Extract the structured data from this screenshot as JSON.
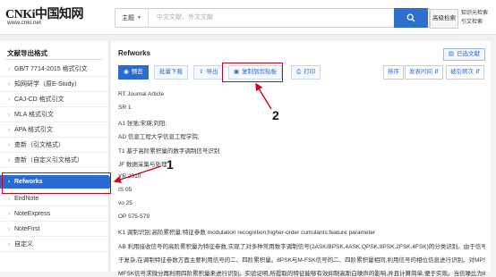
{
  "header": {
    "logo_text": "CNKi中国知网",
    "logo_url": "www.cnki.net",
    "search_select": "主题",
    "search_placeholder": "中文文献、外文文献",
    "adv_search": "高级检索",
    "right_links": [
      "知识元检索",
      "引文检索"
    ]
  },
  "sidebar": {
    "title": "文献导出格式",
    "items": [
      {
        "label": "GB/T 7714-2015 格式引文",
        "active": false
      },
      {
        "label": "知网研学（原E-Study）",
        "active": false
      },
      {
        "label": "CAJ-CD 格式引文",
        "active": false
      },
      {
        "label": "MLA 格式引文",
        "active": false
      },
      {
        "label": "APA 格式引文",
        "active": false
      },
      {
        "label": "查新（引文格式）",
        "active": false
      },
      {
        "label": "查新（自定义引文格式）",
        "active": false
      },
      {
        "label": "Refworks",
        "active": true
      },
      {
        "label": "EndNote",
        "active": false
      },
      {
        "label": "NoteExpress",
        "active": false
      },
      {
        "label": "NoteFirst",
        "active": false
      },
      {
        "label": "自定义",
        "active": false
      }
    ]
  },
  "content": {
    "title": "Refworks",
    "selected_btn": "已选文献",
    "toolbar": {
      "preview": "预览",
      "batch_download": "批量下载",
      "export": "导出",
      "copy": "复制到剪贴板",
      "print": "打印"
    },
    "sort": {
      "order": "排序",
      "by_time": "发表时间",
      "by_cite": "被引频次"
    },
    "lines": [
      "RT Journal Article",
      "SR 1",
      "A1 张弛;宋瑛;刘阳;",
      "AD 信息工程大学信息工程学院;",
      "T1 基于高阶累积量的数字调制信号识别",
      "JF 数据采集与处理",
      "YR 2010",
      "IS 05",
      "vo 25",
      "OP 575-579",
      "K1 调制识别;高阶累积量;特征参数 modulation recognition;higher-order cumulants;feature parameter",
      "AB 利用接收信号的高阶累积量为特征参数,实现了对多种常用数字调制信号(2ASK/BPSK,4ASK,QPSK,8PSK,2FSK,4FSK)的分类识别。由于信号六阶以上累积量的计算过",
      "于复杂,在调制特征参数方面主要利用信号的二、四阶累积量。8PSK与M-FSK信号的二、四阶累积量相同,利用信号的相位信息进行识别。对MPSK信号,在...",
      "MFSK信号求微分再利用四阶累积量来进行识别。实验证明,所提取的特征能够有效抑制高斯白噪声的影响,并且计算简单,便于实现。当信噪比为8 dB时,识别率基本达到10"
    ]
  },
  "annotations": {
    "label1": "1",
    "label2": "2"
  },
  "colors": {
    "accent": "#2a6bd1",
    "annotation_red": "#d0021b"
  }
}
